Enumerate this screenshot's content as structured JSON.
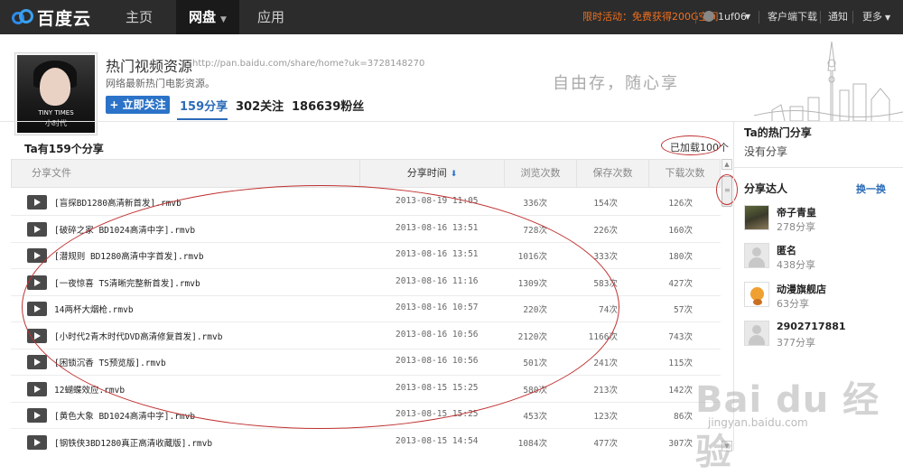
{
  "topnav": {
    "logo": "百度云",
    "items": [
      {
        "label": "主页"
      },
      {
        "label": "网盘"
      },
      {
        "label": "应用"
      }
    ],
    "promo": "限时活动：免费获得200G空间",
    "username": "1uf06",
    "client_download": "客户端下载",
    "notify": "通知",
    "more": "更多"
  },
  "profile": {
    "avatar_caption_1": "TINY TIMES",
    "avatar_caption_2": "小时代",
    "title": "热门视频资源",
    "url": "http://pan.baidu.com/share/home?uk=3728148270",
    "desc": "网络最新热门电影资源。",
    "follow_label": "+ 立即关注",
    "shares": "159分享",
    "following": "302关注",
    "fans": "186639粉丝",
    "slogan": "自由存，随心享"
  },
  "list": {
    "count_title": "Ta有159个分享",
    "loaded": "已加载100个",
    "headers": {
      "file": "分享文件",
      "time": "分享时间",
      "views": "浏览次数",
      "saves": "保存次数",
      "downloads": "下载次数"
    },
    "rows": [
      {
        "name": "[盲探BD1280高清新首发].rmvb",
        "time": "2013-08-19 11:05",
        "views": "336次",
        "saves": "154次",
        "downloads": "126次"
      },
      {
        "name": "[破碎之家 BD1024高清中字].rmvb",
        "time": "2013-08-16 13:51",
        "views": "728次",
        "saves": "226次",
        "downloads": "160次"
      },
      {
        "name": "[潜规则 BD1280高清中字首发].rmvb",
        "time": "2013-08-16 13:51",
        "views": "1016次",
        "saves": "333次",
        "downloads": "180次"
      },
      {
        "name": "[一夜惊喜 TS清晰完整新首发].rmvb",
        "time": "2013-08-16 11:16",
        "views": "1309次",
        "saves": "583次",
        "downloads": "427次"
      },
      {
        "name": "14两杯大烟枪.rmvb",
        "time": "2013-08-16 10:57",
        "views": "220次",
        "saves": "74次",
        "downloads": "57次"
      },
      {
        "name": "[小时代2青木时代DVD高清修复首发].rmvb",
        "time": "2013-08-16 10:56",
        "views": "2120次",
        "saves": "1166次",
        "downloads": "743次"
      },
      {
        "name": "[困锁沉香 TS预览版].rmvb",
        "time": "2013-08-16 10:56",
        "views": "501次",
        "saves": "241次",
        "downloads": "115次"
      },
      {
        "name": "12蝴蝶效应.rmvb",
        "time": "2013-08-15 15:25",
        "views": "580次",
        "saves": "213次",
        "downloads": "142次"
      },
      {
        "name": "[黄色大象 BD1024高清中字].rmvb",
        "time": "2013-08-15 15:25",
        "views": "453次",
        "saves": "123次",
        "downloads": "86次"
      },
      {
        "name": "[钢铁侠3BD1280真正高清收藏版].rmvb",
        "time": "2013-08-15 14:54",
        "views": "1084次",
        "saves": "477次",
        "downloads": "307次"
      }
    ]
  },
  "sidebar": {
    "hot_title": "Ta的热门分享",
    "hot_empty": "没有分享",
    "fans_title": "分享达人",
    "swap_label": "换一换",
    "fans": [
      {
        "name": "帝子青皇",
        "count": "278",
        "unit": "分享"
      },
      {
        "name": "匿名",
        "count": "438",
        "unit": "分享"
      },
      {
        "name": "动漫旗舰店",
        "count": "63",
        "unit": "分享"
      },
      {
        "name": "2902717881",
        "count": "377",
        "unit": "分享"
      }
    ]
  },
  "watermark": {
    "text": "Bai du 经验",
    "url": "jingyan.baidu.com"
  },
  "colors": {
    "accent": "#2b6cb8",
    "promo": "#f07020",
    "annotation": "#c03030",
    "nav_bg": "#2c2c2c"
  }
}
